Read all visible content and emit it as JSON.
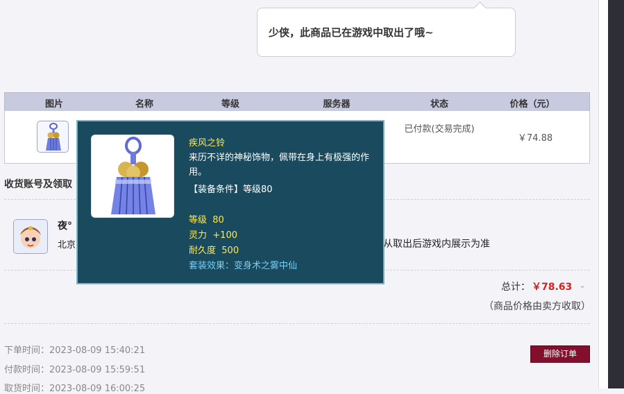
{
  "bubble": {
    "message": "少侠，此商品已在游戏中取出了哦~"
  },
  "table": {
    "headers": [
      "图片",
      "名称",
      "等级",
      "服务器",
      "状态",
      "价格（元）"
    ],
    "row": {
      "status": "已付款(交易完成)",
      "price": "￥74.88"
    }
  },
  "section": {
    "title": "收货账号及领取"
  },
  "seller": {
    "name": "夜°",
    "location": "北京",
    "note": "从取出后游戏内展示为准"
  },
  "summary": {
    "total_label": "总计：",
    "total_amount": "￥78.63",
    "note": "（商品价格由卖方收取）"
  },
  "times": [
    {
      "label": "下单时间：",
      "value": "2023-08-09 15:40:21"
    },
    {
      "label": "付款时间：",
      "value": "2023-08-09 15:59:51"
    },
    {
      "label": "取货时间：",
      "value": "2023-08-09 16:00:25"
    }
  ],
  "actions": {
    "delete": "删除订单"
  },
  "item_tooltip": {
    "name": "疾风之铃",
    "description": "来历不详的神秘饰物，佩带在身上有极强的作用。",
    "requirement": "【装备条件】等级80",
    "stats": [
      {
        "label": "等级",
        "value": "80"
      },
      {
        "label": "灵力",
        "value": "+100"
      },
      {
        "label": "耐久度",
        "value": "500"
      }
    ],
    "set_effect": "套装效果：变身术之雾中仙"
  },
  "icons": {
    "item": "bell-tassel-icon",
    "seller_avatar": "avatar-icon",
    "expand": "chevron-down-icon"
  },
  "colors": {
    "accent_red": "#d1231f",
    "delete_button": "#820f2c",
    "tooltip_bg": "#1a4a5d",
    "header_bg": "#c8cae0"
  }
}
